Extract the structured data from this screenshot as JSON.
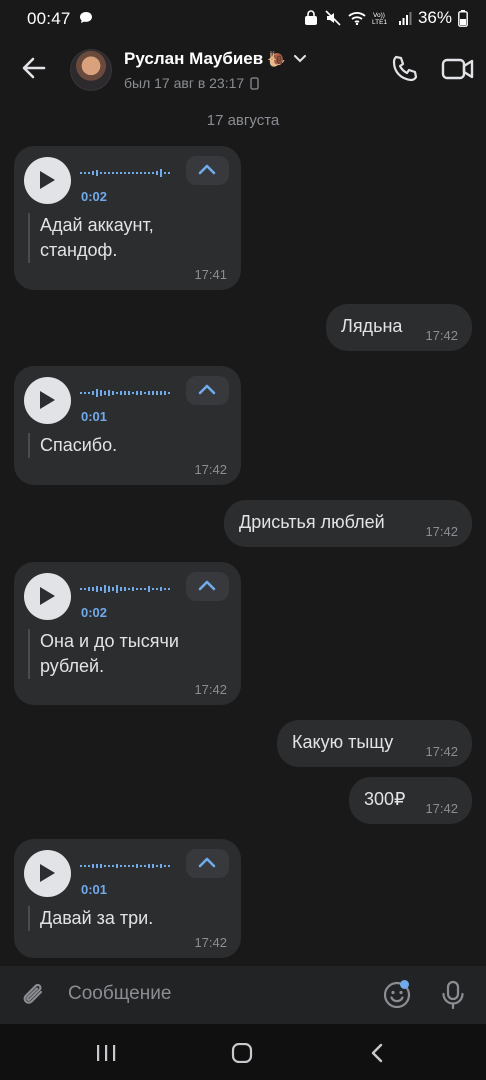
{
  "status_bar": {
    "time": "00:47",
    "battery": "36%"
  },
  "header": {
    "contact_name": "Руслан Маубиев",
    "name_emoji": "🐌",
    "last_seen": "был 17 авг в 23:17"
  },
  "date_separator": "17 августа",
  "messages": [
    {
      "type": "voice",
      "direction": "in",
      "duration": "0:02",
      "transcript_lines": [
        "Адай аккаунт,",
        "стандоф."
      ],
      "time": "17:41"
    },
    {
      "type": "text",
      "direction": "out",
      "text": "Лядьна",
      "time": "17:42"
    },
    {
      "type": "voice",
      "direction": "in",
      "duration": "0:01",
      "transcript_lines": [
        "Спасибо."
      ],
      "time": "17:42"
    },
    {
      "type": "text",
      "direction": "out",
      "text": "Дрисьтья люблей",
      "time": "17:42"
    },
    {
      "type": "voice",
      "direction": "in",
      "duration": "0:02",
      "transcript_lines": [
        "Она и до тысячи",
        "рублей."
      ],
      "time": "17:42"
    },
    {
      "type": "text",
      "direction": "out",
      "text": "Какую тыщу",
      "time": "17:42"
    },
    {
      "type": "text",
      "direction": "out",
      "text": "300₽",
      "time": "17:42"
    },
    {
      "type": "voice",
      "direction": "in",
      "duration": "0:01",
      "transcript_lines": [
        "Давай за три."
      ],
      "time": "17:42"
    }
  ],
  "composer": {
    "placeholder": "Сообщение"
  },
  "colors": {
    "background": "#19191a",
    "bubble": "#2c2d2f",
    "accent": "#71aaeb",
    "muted": "#8a8d92"
  },
  "icons": [
    "back-arrow-icon",
    "phone-icon",
    "video-camera-icon",
    "play-icon",
    "chevron-up-icon",
    "paperclip-icon",
    "emoji-icon",
    "microphone-icon"
  ]
}
